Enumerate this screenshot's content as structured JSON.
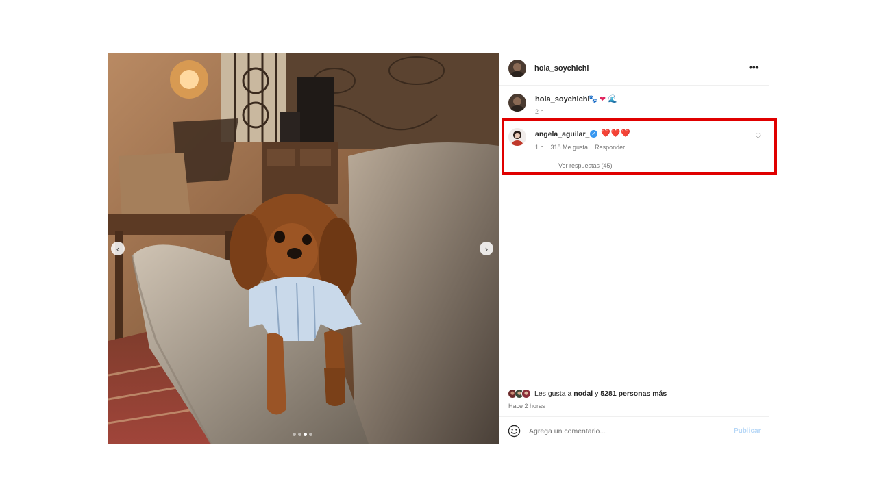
{
  "post": {
    "author": "hola_soychichi",
    "more_icon": "more-horizontal-icon",
    "more_label": "•••",
    "carousel": {
      "prev_label": "‹",
      "next_label": "›",
      "total": 4,
      "active": 2
    }
  },
  "caption": {
    "username": "hola_soychichi",
    "emojis": [
      "🐾",
      "❤",
      "🌊"
    ],
    "time": "2 h"
  },
  "comment": {
    "username": "angela_aguilar_",
    "verified_icon": "verified-badge-icon",
    "verified_glyph": "✓",
    "text": "❤️❤️❤️",
    "time": "1 h",
    "likes": "318 Me gusta",
    "reply_label": "Responder",
    "like_icon": "heart-outline-icon",
    "like_glyph": "♡",
    "view_replies": "Ver respuestas (45)"
  },
  "likes": {
    "prefix": "Les gusta a",
    "friend": "nodal",
    "connector": "y",
    "others": "5281 personas más"
  },
  "posted_time": "Hace 2 horas",
  "add_comment": {
    "placeholder": "Agrega un comentario...",
    "publish_label": "Publicar",
    "emoji_icon": "smiley-face-icon"
  },
  "colors": {
    "highlight_border": "#e00000",
    "verified": "#3897f0",
    "heart": "#ed1c3a",
    "publish_disabled": "#b6d7f7"
  }
}
